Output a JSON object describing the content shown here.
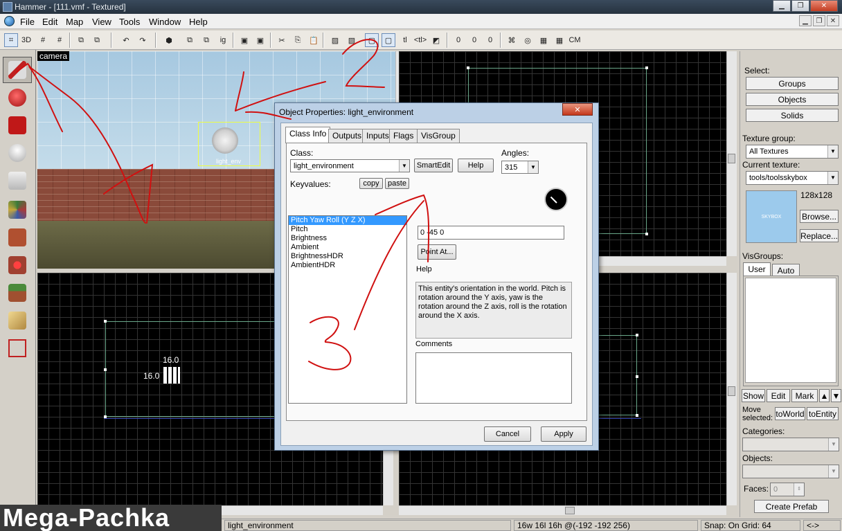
{
  "window": {
    "title": "Hammer - [111.vmf - Textured]"
  },
  "menubar": {
    "items": [
      "File",
      "Edit",
      "Map",
      "View",
      "Tools",
      "Window",
      "Help"
    ]
  },
  "toolbar": {
    "glyphs": [
      "⌗",
      "3D",
      "#",
      "#",
      "⧉",
      "⧉",
      "↶",
      "↷",
      "⬢",
      "⧉",
      "⧉",
      "ig",
      "▣",
      "▣",
      "✂",
      "⎘",
      "📋",
      "▨",
      "▨",
      "▢",
      "▢",
      "tl",
      "<tl>",
      "◩",
      "0",
      "0",
      "0",
      "⌘",
      "◎",
      "▦",
      "▦",
      "CM"
    ]
  },
  "camera": {
    "label": "camera",
    "entity_caption": "light_env"
  },
  "view_bottomleft": {
    "label_w": "16.0",
    "label_h": "16.0"
  },
  "dialog": {
    "title": "Object Properties: light_environment",
    "close": "✕",
    "tabs": [
      "Class Info",
      "Outputs",
      "Inputs",
      "Flags",
      "VisGroup"
    ],
    "class_label": "Class:",
    "class_value": "light_environment",
    "smartedit": "SmartEdit",
    "help_btn": "Help",
    "angles_label": "Angles:",
    "angles_value": "315",
    "keyvalues_label": "Keyvalues:",
    "copy": "copy",
    "paste": "paste",
    "keyvalues": [
      "Pitch Yaw Roll (Y Z X)",
      "Pitch",
      "Brightness",
      "Ambient",
      "BrightnessHDR",
      "AmbientHDR"
    ],
    "value_field": "0 -45 0",
    "point_at": "Point At...",
    "help_label": "Help",
    "help_text": "This entity's orientation in the world. Pitch is rotation around the Y axis, yaw is the rotation around the Z axis, roll is the rotation around the X axis.",
    "comments_label": "Comments",
    "cancel": "Cancel",
    "apply": "Apply"
  },
  "rightpanel": {
    "select_label": "Select:",
    "groups": "Groups",
    "objects_btn": "Objects",
    "solids": "Solids",
    "texture_group_label": "Texture group:",
    "texture_group_value": "All Textures",
    "current_texture_label": "Current texture:",
    "current_texture_value": "tools/toolsskybox",
    "texture_size": "128x128",
    "texture_thumb_text": "SKYBOX",
    "browse": "Browse...",
    "replace": "Replace...",
    "visgroups_label": "VisGroups:",
    "tab_user": "User",
    "tab_auto": "Auto",
    "show": "Show",
    "edit": "Edit",
    "mark": "Mark",
    "move_selected": "Move selected:",
    "to_world": "toWorld",
    "to_entity": "toEntity",
    "categories_label": "Categories:",
    "objects_label": "Objects:",
    "faces_label": "Faces:",
    "faces_value": "0",
    "create_prefab": "Create Prefab"
  },
  "statusbar": {
    "entity": "light_environment",
    "size": "16w 16l 16h @(-192 -192 256)",
    "snap": "Snap: On Grid: 64",
    "arrows": "<->"
  },
  "watermark": "Mega-Pachka",
  "annotations": [
    "1",
    "2",
    "3"
  ],
  "colors": {
    "annotation": "#d01010",
    "selection": "#3399ff",
    "entity_box": "#f0ff40"
  }
}
